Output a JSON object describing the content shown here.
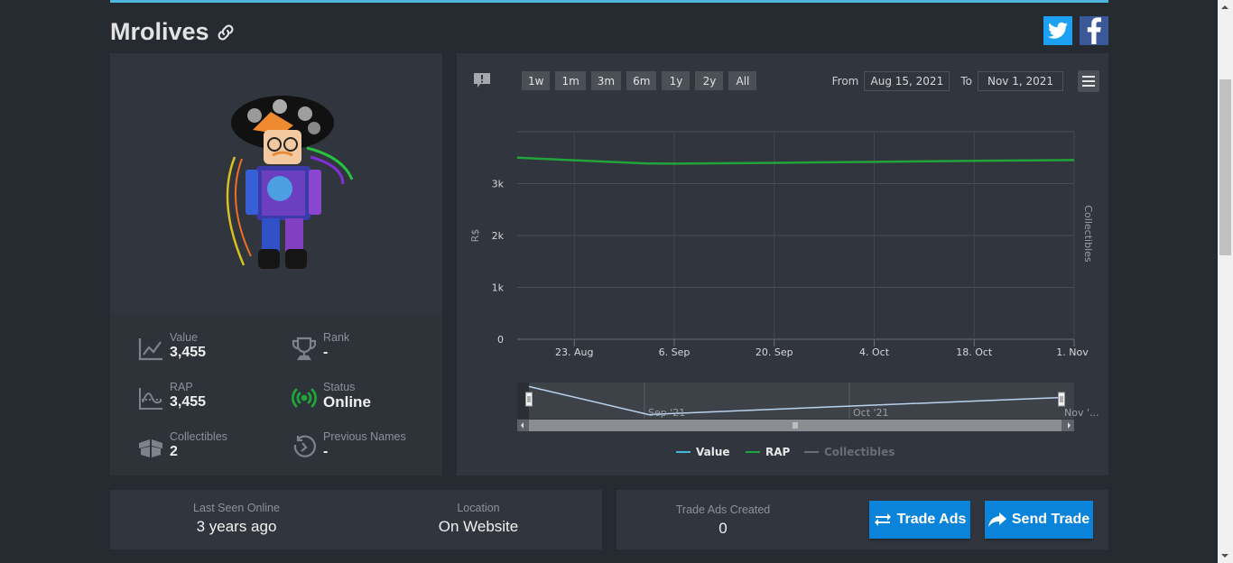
{
  "profile": {
    "username": "Mrolives",
    "link_icon": "link-icon",
    "share": [
      {
        "name": "twitter",
        "icon": "twitter-icon",
        "color": "#1da1f2"
      },
      {
        "name": "facebook",
        "icon": "facebook-icon",
        "color": "#3b5998"
      }
    ]
  },
  "stats": {
    "value": {
      "label": "Value",
      "value": "3,455",
      "icon": "line-chart-icon"
    },
    "rap": {
      "label": "RAP",
      "value": "3,455",
      "icon": "wave-chart-icon"
    },
    "collectibles": {
      "label": "Collectibles",
      "value": "2",
      "icon": "box-open-icon"
    },
    "rank": {
      "label": "Rank",
      "value": "-",
      "icon": "trophy-icon"
    },
    "status": {
      "label": "Status",
      "value": "Online",
      "icon": "broadcast-icon",
      "color": "#1fa53a"
    },
    "previous_names": {
      "label": "Previous Names",
      "value": "-",
      "icon": "history-icon"
    }
  },
  "chart_toolbar": {
    "ranges": [
      "1w",
      "1m",
      "3m",
      "6m",
      "1y",
      "2y",
      "All"
    ],
    "from_label": "From",
    "from_value": "Aug 15, 2021",
    "to_label": "To",
    "to_value": "Nov 1, 2021"
  },
  "chart_data": {
    "type": "line",
    "title": "",
    "xlabel": "",
    "ylabel": "R$",
    "y2label": "Collectibles",
    "x_start": "2021-08-15",
    "x_end": "2021-11-01",
    "x_ticks": [
      "23. Aug",
      "6. Sep",
      "20. Sep",
      "4. Oct",
      "18. Oct",
      "1. Nov"
    ],
    "y_ticks": [
      "0",
      "1k",
      "2k",
      "3k"
    ],
    "ylim": [
      0,
      4000
    ],
    "grid": true,
    "x": [
      "2021-08-15",
      "2021-08-23",
      "2021-09-02",
      "2021-09-06",
      "2021-09-20",
      "2021-10-04",
      "2021-10-18",
      "2021-11-01"
    ],
    "series": [
      {
        "name": "Value",
        "color": "#44b8d8",
        "values": [
          null,
          null,
          null,
          null,
          null,
          null,
          null,
          null
        ]
      },
      {
        "name": "RAP",
        "color": "#1fa53a",
        "values": [
          3500,
          3450,
          3390,
          3385,
          3400,
          3420,
          3440,
          3455
        ]
      },
      {
        "name": "Collectibles",
        "color": "#6a6e74",
        "values": [
          null,
          null,
          null,
          null,
          null,
          null,
          null,
          null
        ]
      }
    ],
    "navigator": {
      "labels": [
        "Sep '21",
        "Oct '21",
        "Nov '..."
      ],
      "values": [
        3500,
        3385,
        3390,
        3420,
        3455
      ]
    },
    "legend": [
      {
        "name": "Value",
        "color": "#44b8d8",
        "active": true
      },
      {
        "name": "RAP",
        "color": "#1fa53a",
        "active": true
      },
      {
        "name": "Collectibles",
        "color": "#6a6e74",
        "active": false
      }
    ],
    "legend_position": "bottom"
  },
  "presence": {
    "last_seen_label": "Last Seen Online",
    "last_seen_value": "3 years ago",
    "location_label": "Location",
    "location_value": "On Website"
  },
  "trade": {
    "ads_label": "Trade Ads Created",
    "ads_value": "0",
    "trade_ads_button": "Trade Ads",
    "send_trade_button": "Send Trade"
  }
}
